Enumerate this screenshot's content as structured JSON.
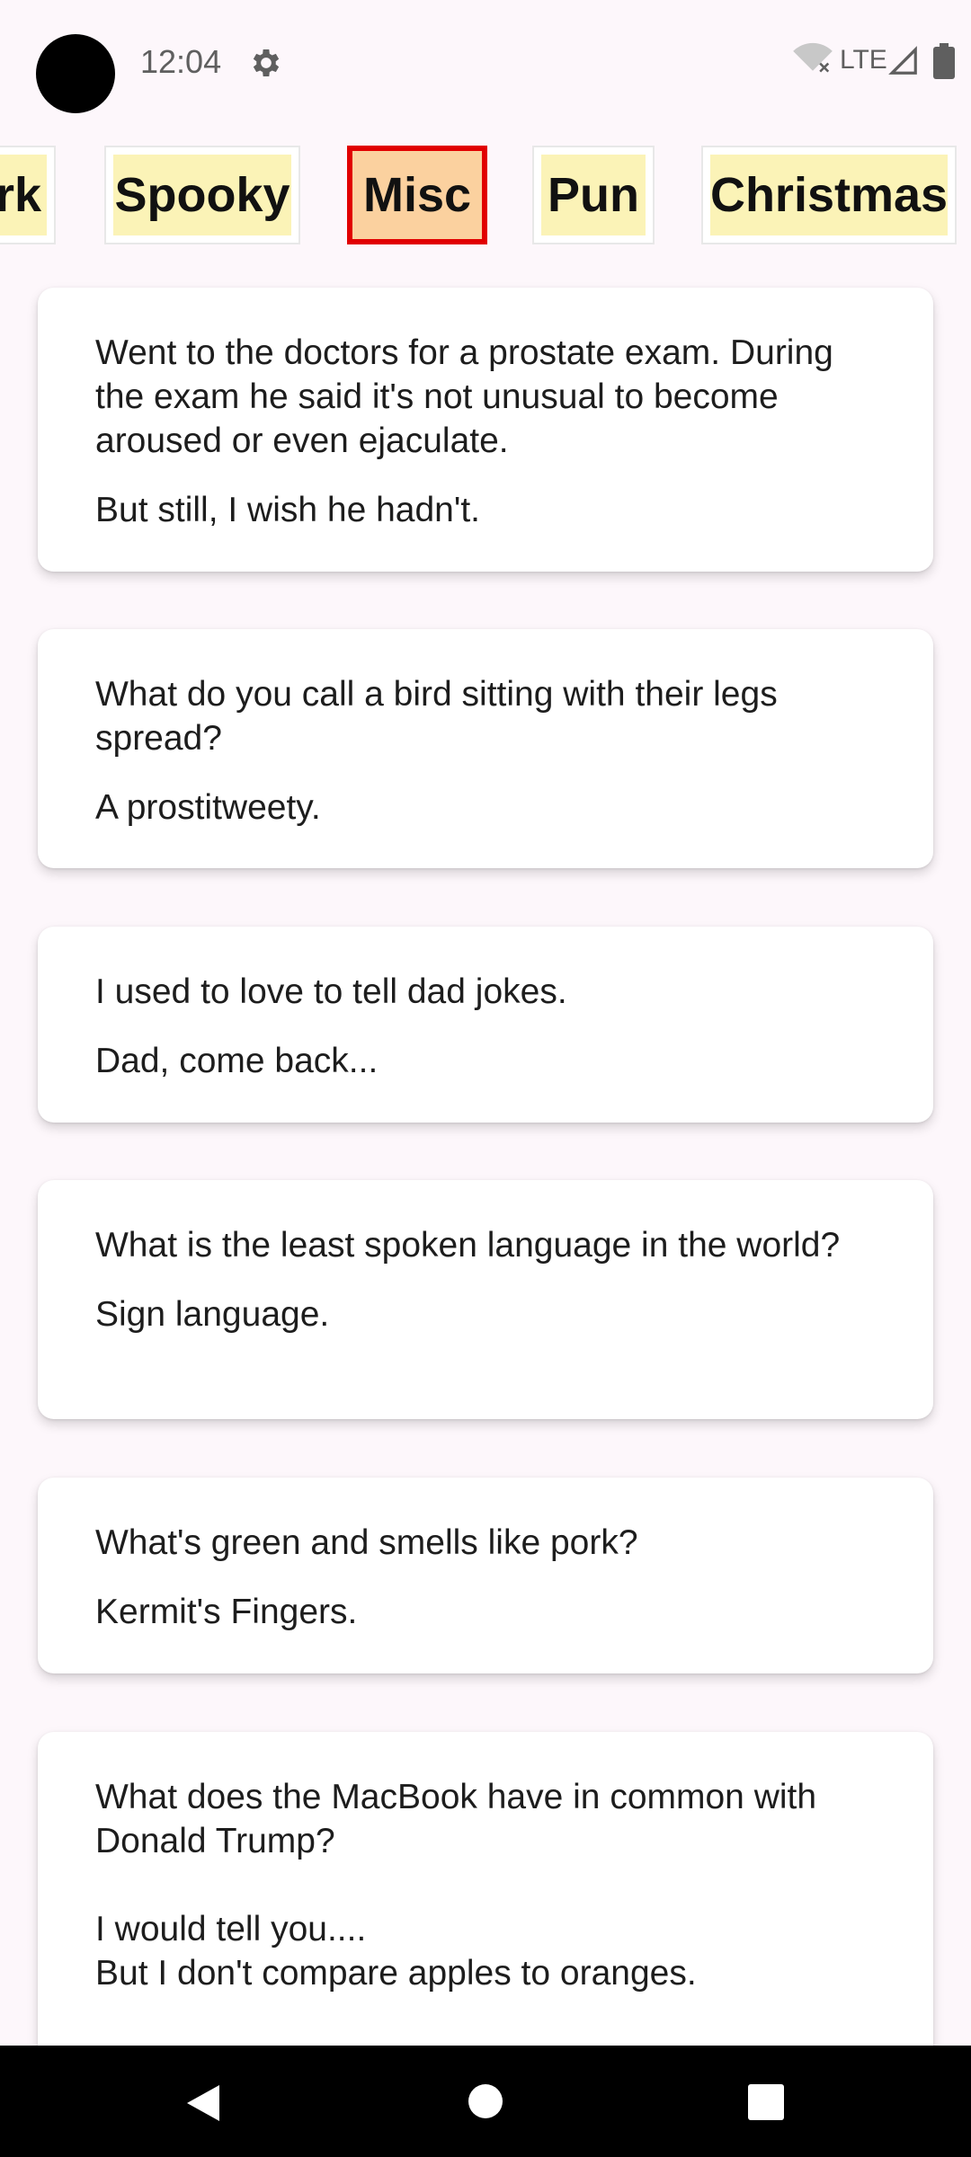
{
  "status_bar": {
    "time": "12:04",
    "network": "LTE",
    "icons": [
      "settings-icon",
      "wifi-off-icon",
      "signal-icon",
      "battery-icon"
    ]
  },
  "categories": [
    {
      "label": "rk",
      "selected": false
    },
    {
      "label": "Spooky",
      "selected": false
    },
    {
      "label": "Misc",
      "selected": true
    },
    {
      "label": "Pun",
      "selected": false
    },
    {
      "label": "Christmas",
      "selected": false
    }
  ],
  "jokes": [
    {
      "setup": "Went to the doctors for a prostate exam. During the exam he said it's not unusual to become aroused or even ejaculate.",
      "punchline": "But still, I wish he hadn't."
    },
    {
      "setup": "What do you call a bird sitting with their legs spread?",
      "punchline": "A prostitweety."
    },
    {
      "setup": "I used to love to tell dad jokes.",
      "punchline": "Dad, come back..."
    },
    {
      "setup": "What is the least spoken language in the world?",
      "punchline": "Sign language."
    },
    {
      "setup": "What's green and smells like pork?",
      "punchline": "Kermit's Fingers."
    },
    {
      "setup": "What does the MacBook have in common with Donald Trump?\n\nI would tell you....\nBut I don't compare apples to oranges.",
      "punchline": ""
    }
  ],
  "colors": {
    "chip_fill": "#fbf3b7",
    "chip_selected_fill": "#fbd19f",
    "chip_selected_border": "#e10000",
    "background": "#fdf7fb"
  },
  "nav_bar": {
    "icons": [
      "back-icon",
      "home-icon",
      "recents-icon"
    ]
  }
}
